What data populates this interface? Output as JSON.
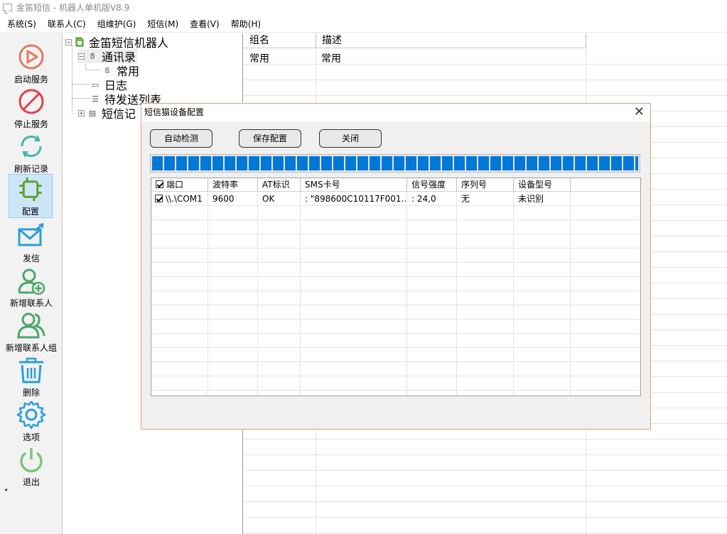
{
  "window": {
    "title": "金笛短信 - 机器人单机版V8.9"
  },
  "menu": [
    "系统(S)",
    "联系人(C)",
    "组维护(G)",
    "短信(M)",
    "查看(V)",
    "帮助(H)"
  ],
  "toolbar": [
    {
      "label": "启动服务",
      "icon": "play-icon"
    },
    {
      "label": "停止服务",
      "icon": "stop-icon"
    },
    {
      "label": "刷新记录",
      "icon": "refresh-icon"
    },
    {
      "label": "配置",
      "icon": "chip-config-icon"
    },
    {
      "label": "发信",
      "icon": "send-mail-icon"
    },
    {
      "label": "新增联系人",
      "icon": "add-contact-icon"
    },
    {
      "label": "新增联系人组",
      "icon": "add-group-icon"
    },
    {
      "label": "删除",
      "icon": "trash-icon"
    },
    {
      "label": "选项",
      "icon": "gear-icon"
    },
    {
      "label": "退出",
      "icon": "power-icon"
    }
  ],
  "tree": {
    "root": "金笛短信机器人",
    "contacts": "通讯录",
    "group_common": "常用",
    "log": "日志",
    "outbox": "待发送列表",
    "sms_records": "短信记"
  },
  "group_grid": {
    "headers": [
      "组名",
      "描述"
    ],
    "rows": [
      [
        "常用",
        "常用"
      ]
    ]
  },
  "dialog": {
    "title": "短信猫设备配置",
    "buttons": {
      "auto_detect": "自动检测",
      "save": "保存配置",
      "close": "关闭"
    },
    "progress_percent": 100,
    "device_table": {
      "headers": [
        "端口",
        "波特率",
        "AT标识",
        "SMS卡号",
        "信号强度",
        "序列号",
        "设备型号"
      ],
      "rows": [
        {
          "checked": true,
          "port": "\\\\.\\COM1",
          "baud": "9600",
          "at": "OK",
          "sms": ": \"898600C10117F001...",
          "signal": ": 24,0",
          "serial": "无",
          "model": "未识别"
        }
      ]
    }
  },
  "colors": {
    "progress": "#0078d7",
    "active_tool_bg": "#cde6f7",
    "dialog_border": "#d9a177"
  }
}
